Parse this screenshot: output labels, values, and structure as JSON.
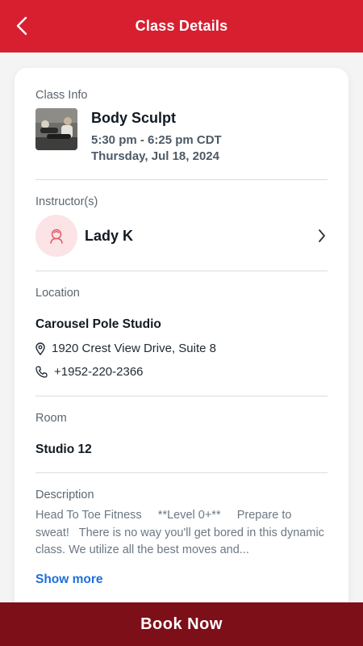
{
  "header": {
    "title": "Class Details",
    "back_icon": "chevron-left-icon"
  },
  "class_info": {
    "label": "Class Info",
    "name": "Body Sculpt",
    "time": "5:30 pm - 6:25 pm CDT",
    "date": "Thursday, Jul 18, 2024"
  },
  "instructors": {
    "label": "Instructor(s)",
    "name": "Lady K",
    "avatar_icon": "person-icon"
  },
  "location": {
    "label": "Location",
    "name": "Carousel Pole Studio",
    "address": "1920 Crest View Drive, Suite 8",
    "phone": "+1952-220-2366"
  },
  "room": {
    "label": "Room",
    "name": "Studio 12"
  },
  "description": {
    "label": "Description",
    "text": "Head To Toe Fitness     **Level 0+**     Prepare to sweat!   There is no way you'll get bored in this dynamic class. We utilize all the best moves and...",
    "show_more": "Show more"
  },
  "footer": {
    "book_label": "Book Now"
  },
  "colors": {
    "header_red": "#d71f30",
    "button_dark_red": "#7d0f18",
    "link_blue": "#1e6fd9",
    "avatar_bg": "#fbe3e6"
  }
}
